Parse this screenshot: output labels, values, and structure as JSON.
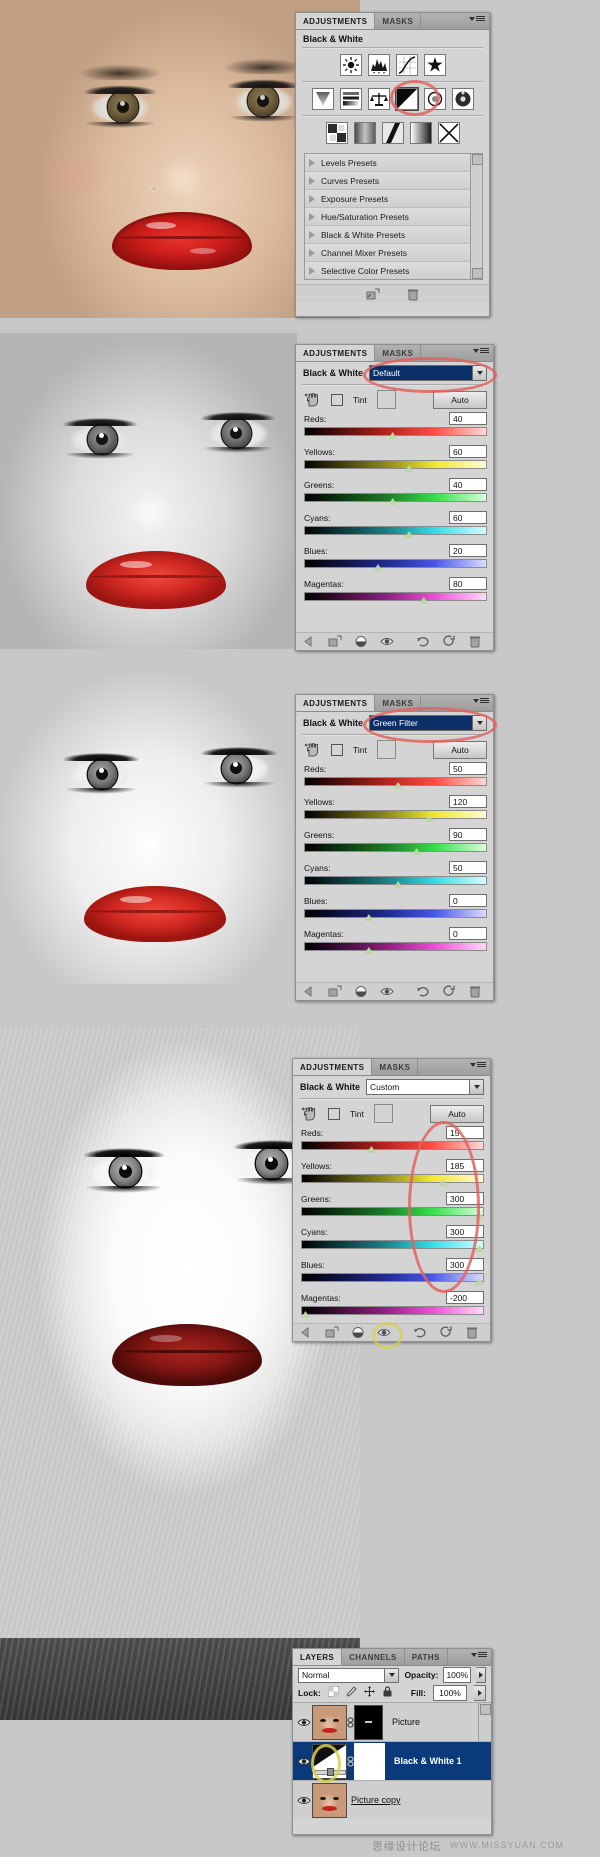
{
  "panels": {
    "adjustments": {
      "tabs": [
        {
          "label": "ADJUSTMENTS",
          "active": true
        },
        {
          "label": "MASKS",
          "active": false
        }
      ],
      "title": "Black & White"
    },
    "layers": {
      "tabs": [
        {
          "label": "LAYERS",
          "active": true
        },
        {
          "label": "CHANNELS",
          "active": false
        },
        {
          "label": "PATHS",
          "active": false
        }
      ],
      "blend_mode": "Normal",
      "opacity_label": "Opacity:",
      "opacity_value": "100%",
      "lock_label": "Lock:",
      "fill_label": "Fill:",
      "fill_value": "100%",
      "rows": [
        {
          "name": "Picture",
          "selected": false,
          "has_mask": true
        },
        {
          "name": "Black & White 1",
          "selected": true,
          "has_mask": true
        },
        {
          "name": "Picture copy",
          "selected": false,
          "has_mask": false
        }
      ]
    }
  },
  "panel1": {
    "icon_rows": [
      [
        "brightness-contrast-icon",
        "levels-icon",
        "curves-icon",
        "exposure-icon"
      ],
      [
        "vibrance-icon",
        "hue-saturation-icon",
        "color-balance-icon",
        "black-white-icon",
        "photo-filter-icon",
        "channel-mixer-icon"
      ],
      [
        "invert-icon",
        "posterize-icon",
        "threshold-icon",
        "gradient-map-icon",
        "selective-color-icon"
      ]
    ],
    "presets": [
      "Levels Presets",
      "Curves Presets",
      "Exposure Presets",
      "Hue/Saturation Presets",
      "Black & White Presets",
      "Channel Mixer Presets",
      "Selective Color Presets"
    ]
  },
  "panel2": {
    "preset": "Default",
    "tint_label": "Tint",
    "auto_label": "Auto",
    "sliders": [
      {
        "label": "Reds:",
        "value": "40",
        "pos": 46
      },
      {
        "label": "Yellows:",
        "value": "60",
        "pos": 55
      },
      {
        "label": "Greens:",
        "value": "40",
        "pos": 46
      },
      {
        "label": "Cyans:",
        "value": "60",
        "pos": 55
      },
      {
        "label": "Blues:",
        "value": "20",
        "pos": 38
      },
      {
        "label": "Magentas:",
        "value": "80",
        "pos": 63
      }
    ]
  },
  "panel3": {
    "preset": "Green Filter",
    "tint_label": "Tint",
    "auto_label": "Auto",
    "sliders": [
      {
        "label": "Reds:",
        "value": "50",
        "pos": 49
      },
      {
        "label": "Yellows:",
        "value": "120",
        "pos": 66
      },
      {
        "label": "Greens:",
        "value": "90",
        "pos": 59
      },
      {
        "label": "Cyans:",
        "value": "50",
        "pos": 49
      },
      {
        "label": "Blues:",
        "value": "0",
        "pos": 33
      },
      {
        "label": "Magentas:",
        "value": "0",
        "pos": 33
      }
    ]
  },
  "panel4": {
    "preset": "Custom",
    "tint_label": "Tint",
    "auto_label": "Auto",
    "sliders": [
      {
        "label": "Reds:",
        "value": "15",
        "pos": 36
      },
      {
        "label": "Yellows:",
        "value": "185",
        "pos": 75
      },
      {
        "label": "Greens:",
        "value": "300",
        "pos": 96
      },
      {
        "label": "Cyans:",
        "value": "300",
        "pos": 96
      },
      {
        "label": "Blues:",
        "value": "300",
        "pos": 96
      },
      {
        "label": "Magentas:",
        "value": "-200",
        "pos": 1
      }
    ]
  },
  "watermark": {
    "cn": "思缘设计论坛",
    "url": "WWW.MISSYUAN.COM"
  },
  "colors": {
    "panel_bg": "#d4d4d4",
    "selection_blue": "#0b3a7a",
    "combo_blue": "#0b2f66",
    "highlight_red": "#e2635f",
    "highlight_yellow": "#d8d04a"
  }
}
